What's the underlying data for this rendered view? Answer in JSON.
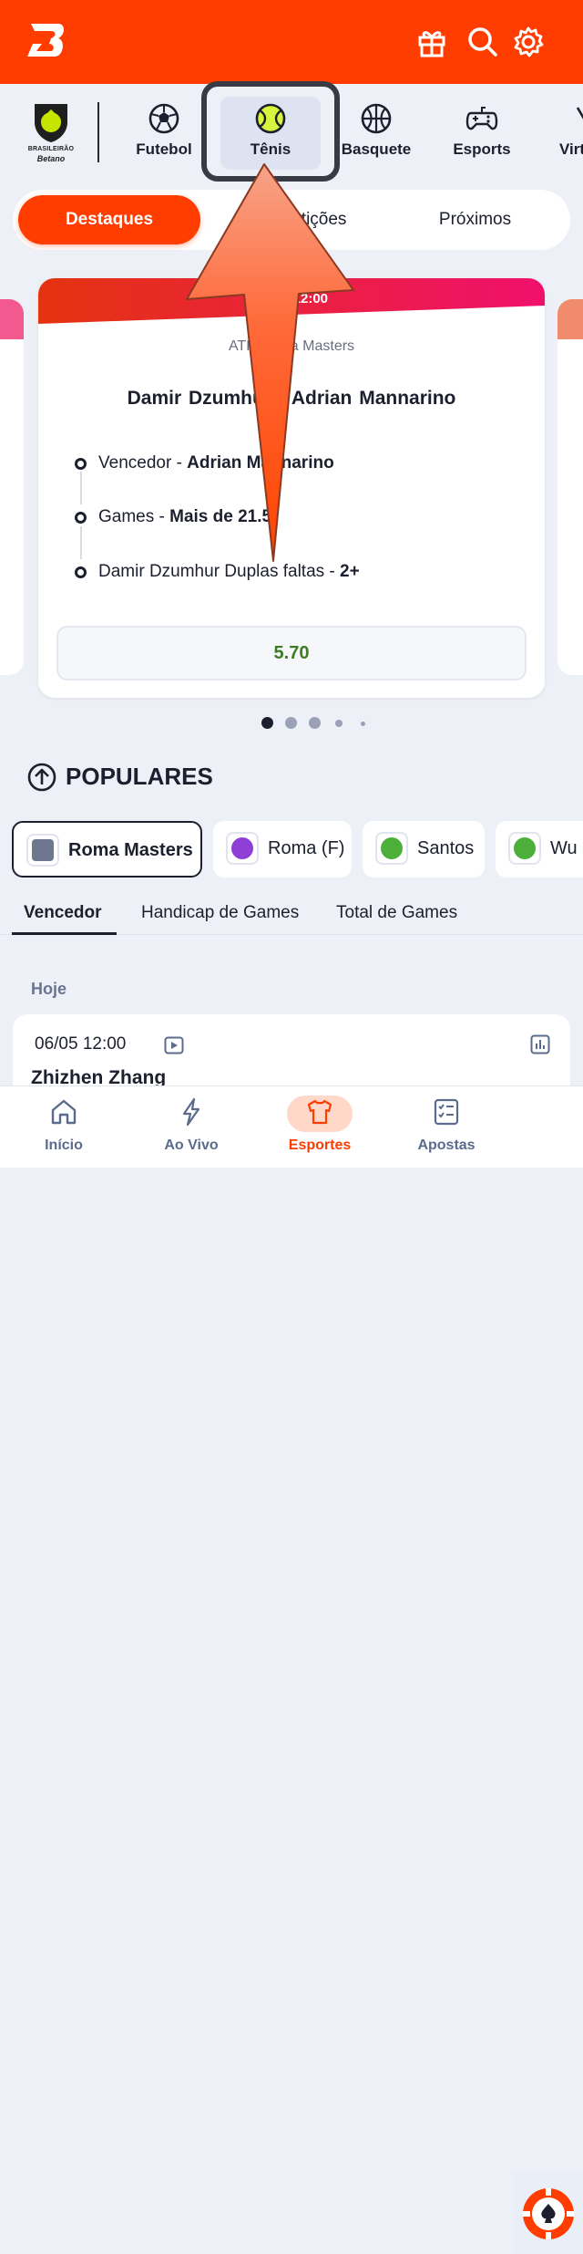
{
  "header": {
    "brand_color": "#ff3d00"
  },
  "categories": {
    "league": {
      "line1": "BRASILEIRÃO",
      "line2": "Betano"
    },
    "items": [
      {
        "label": "Futebol",
        "icon": "soccer-ball-icon"
      },
      {
        "label": "Tênis",
        "icon": "tennis-ball-icon",
        "selected": true
      },
      {
        "label": "Basquete",
        "icon": "basketball-icon"
      },
      {
        "label": "Esports",
        "icon": "gamepad-icon"
      },
      {
        "label": "Virtuais",
        "icon": "virtual-icon"
      }
    ]
  },
  "tabs": {
    "destaques": "Destaques",
    "competicoes": "Competições",
    "proximos": "Próximos"
  },
  "featured": {
    "time": "06/05 12:00",
    "competition": "ATP Roma Masters",
    "match": "Damir Dzumhur - Adrian Mannarino",
    "selections": [
      {
        "label": "Vencedor - ",
        "value": "Adrian Mannarino"
      },
      {
        "label": "Games - ",
        "value": "Mais de 21.5"
      },
      {
        "label": "Damir Dzumhur Duplas faltas - ",
        "value": "2+"
      }
    ],
    "odds": "5.70"
  },
  "popular": {
    "title": "POPULARES",
    "chips": [
      {
        "label": "Roma Masters",
        "icon": "atp-icon"
      },
      {
        "label": "Roma (F)",
        "icon": "wta-icon"
      },
      {
        "label": "Santos",
        "icon": "challenger-icon"
      },
      {
        "label": "Wu",
        "icon": "challenger-icon"
      }
    ],
    "market_tabs": [
      "Vencedor",
      "Handicap de Games",
      "Total de Games"
    ]
  },
  "events": {
    "section": "Hoje",
    "first": {
      "time": "06/05 12:00",
      "player": "Zhizhen Zhang"
    }
  },
  "bottom_nav": [
    {
      "label": "Início",
      "icon": "home-icon"
    },
    {
      "label": "Ao Vivo",
      "icon": "lightning-icon"
    },
    {
      "label": "Esportes",
      "icon": "jersey-icon",
      "active": true
    },
    {
      "label": "Apostas",
      "icon": "betslip-icon"
    }
  ]
}
